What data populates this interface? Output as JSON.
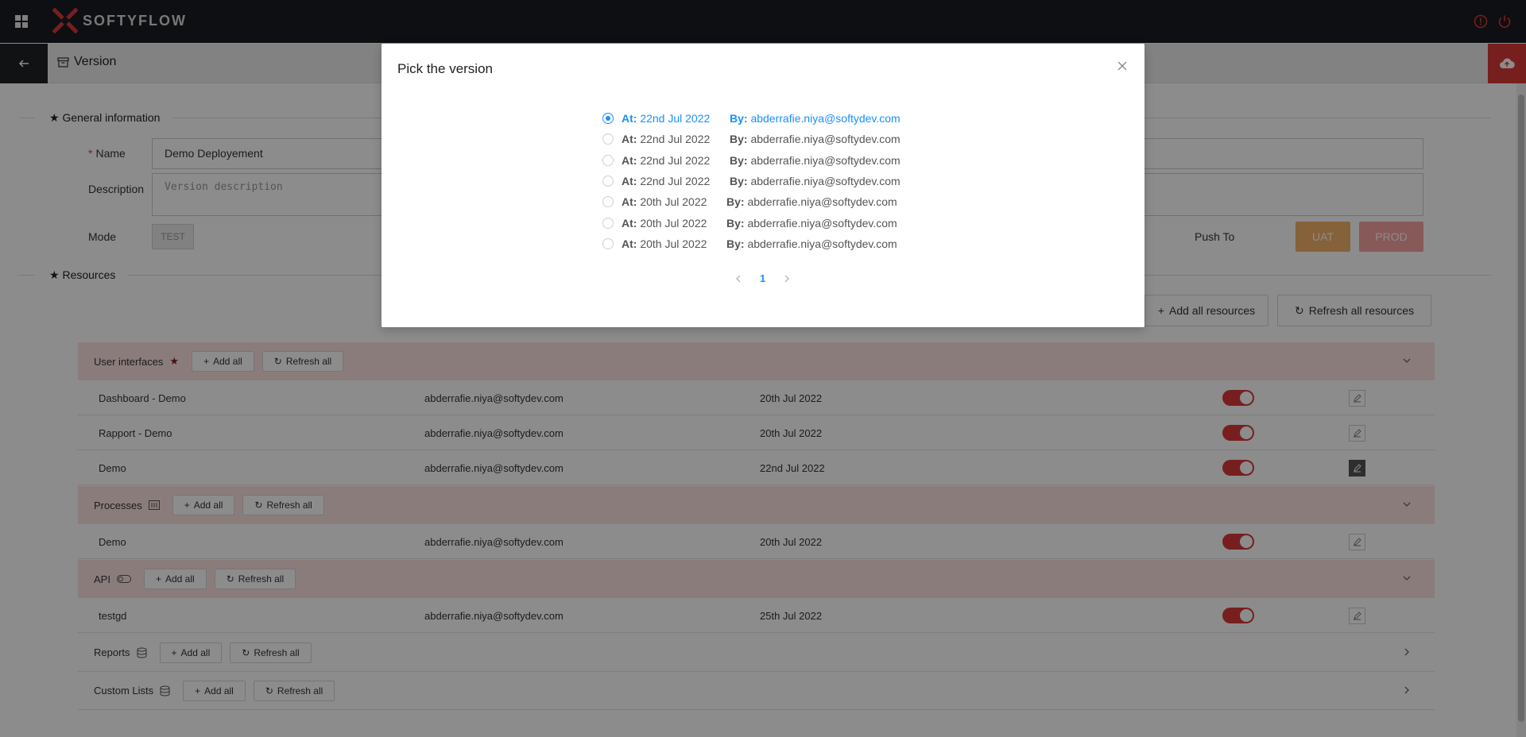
{
  "app": {
    "brand": "SOFTYFLOW"
  },
  "subheader": {
    "title": "Version"
  },
  "general": {
    "section_title": "General information",
    "name_label": "Name",
    "name_value": "Demo Deployement",
    "description_label": "Description",
    "description_placeholder": "Version description",
    "mode_label": "Mode",
    "mode_value": "TEST",
    "push_to_label": "Push To",
    "uat_label": "UAT",
    "prod_label": "PROD"
  },
  "resources": {
    "section_title": "Resources",
    "add_all_resources": "Add all resources",
    "refresh_all_resources": "Refresh all resources",
    "add_all": "Add all",
    "refresh_all": "Refresh all",
    "groups": [
      {
        "name": "User interfaces",
        "rows": [
          {
            "name": "Dashboard - Demo",
            "user": "abderrafie.niya@softydev.com",
            "date": "20th Jul 2022"
          },
          {
            "name": "Rapport - Demo",
            "user": "abderrafie.niya@softydev.com",
            "date": "20th Jul 2022"
          },
          {
            "name": "Demo",
            "user": "abderrafie.niya@softydev.com",
            "date": "22nd Jul 2022"
          }
        ]
      },
      {
        "name": "Processes",
        "rows": [
          {
            "name": "Demo",
            "user": "abderrafie.niya@softydev.com",
            "date": "20th Jul 2022"
          }
        ]
      },
      {
        "name": "API",
        "rows": [
          {
            "name": "testgd",
            "user": "abderrafie.niya@softydev.com",
            "date": "25th Jul 2022"
          }
        ]
      },
      {
        "name": "Reports",
        "rows": []
      },
      {
        "name": "Custom Lists",
        "rows": []
      }
    ]
  },
  "modal": {
    "title": "Pick the version",
    "at_label": "At:",
    "by_label": "By:",
    "options": [
      {
        "date": "22nd Jul 2022",
        "user": "abderrafie.niya@softydev.com"
      },
      {
        "date": "22nd Jul 2022",
        "user": "abderrafie.niya@softydev.com"
      },
      {
        "date": "22nd Jul 2022",
        "user": "abderrafie.niya@softydev.com"
      },
      {
        "date": "22nd Jul 2022",
        "user": "abderrafie.niya@softydev.com"
      },
      {
        "date": "20th Jul 2022",
        "user": "abderrafie.niya@softydev.com"
      },
      {
        "date": "20th Jul 2022",
        "user": "abderrafie.niya@softydev.com"
      },
      {
        "date": "20th Jul 2022",
        "user": "abderrafie.niya@softydev.com"
      }
    ],
    "selected_index": 0,
    "page": "1"
  },
  "colors": {
    "accent_red": "#d93a3a",
    "selection_blue": "#1890ff",
    "group_bg": "#fde2e2"
  }
}
